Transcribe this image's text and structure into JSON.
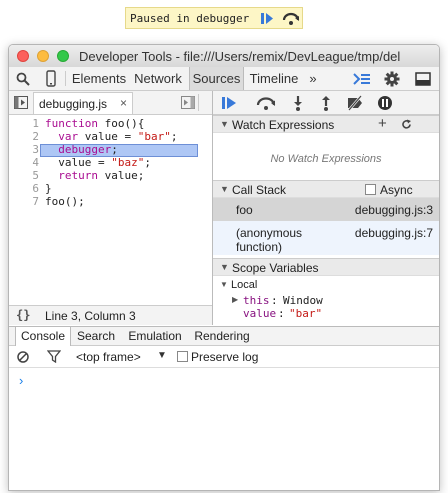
{
  "banner": {
    "text": "Paused in debugger"
  },
  "window": {
    "title": "Developer Tools - file:///Users/remix/DevLeague/tmp/del"
  },
  "tabs": [
    "Elements",
    "Network",
    "Sources",
    "Timeline"
  ],
  "overflow": "»",
  "editor": {
    "filename": "debugging.js",
    "close": "×",
    "line_numbers": [
      "1",
      "2",
      "3",
      "4",
      "5",
      "6",
      "7"
    ],
    "status": "Line 3, Column 3",
    "status_icon": "{}"
  },
  "watch": {
    "title": "Watch Expressions",
    "add": "+",
    "empty": "No Watch Expressions"
  },
  "callstack": {
    "title": "Call Stack",
    "async_label": "Async",
    "frames": [
      {
        "fn": "foo",
        "loc": "debugging.js:3"
      },
      {
        "fn": "(anonymous",
        "fn2": "function)",
        "loc": "debugging.js:7"
      }
    ]
  },
  "scope": {
    "title": "Scope Variables",
    "local": "Local",
    "this_key": "this",
    "this_val": "Window",
    "value_key": "value",
    "value_val": "\"bar\""
  },
  "drawer": {
    "tabs": [
      "Console",
      "Search",
      "Emulation",
      "Rendering"
    ],
    "frame_select": "<top frame>",
    "preserve_log": "Preserve log",
    "prompt": "›"
  },
  "colors": {
    "accent": "#3879d9",
    "highlight": "#aec7f5"
  }
}
